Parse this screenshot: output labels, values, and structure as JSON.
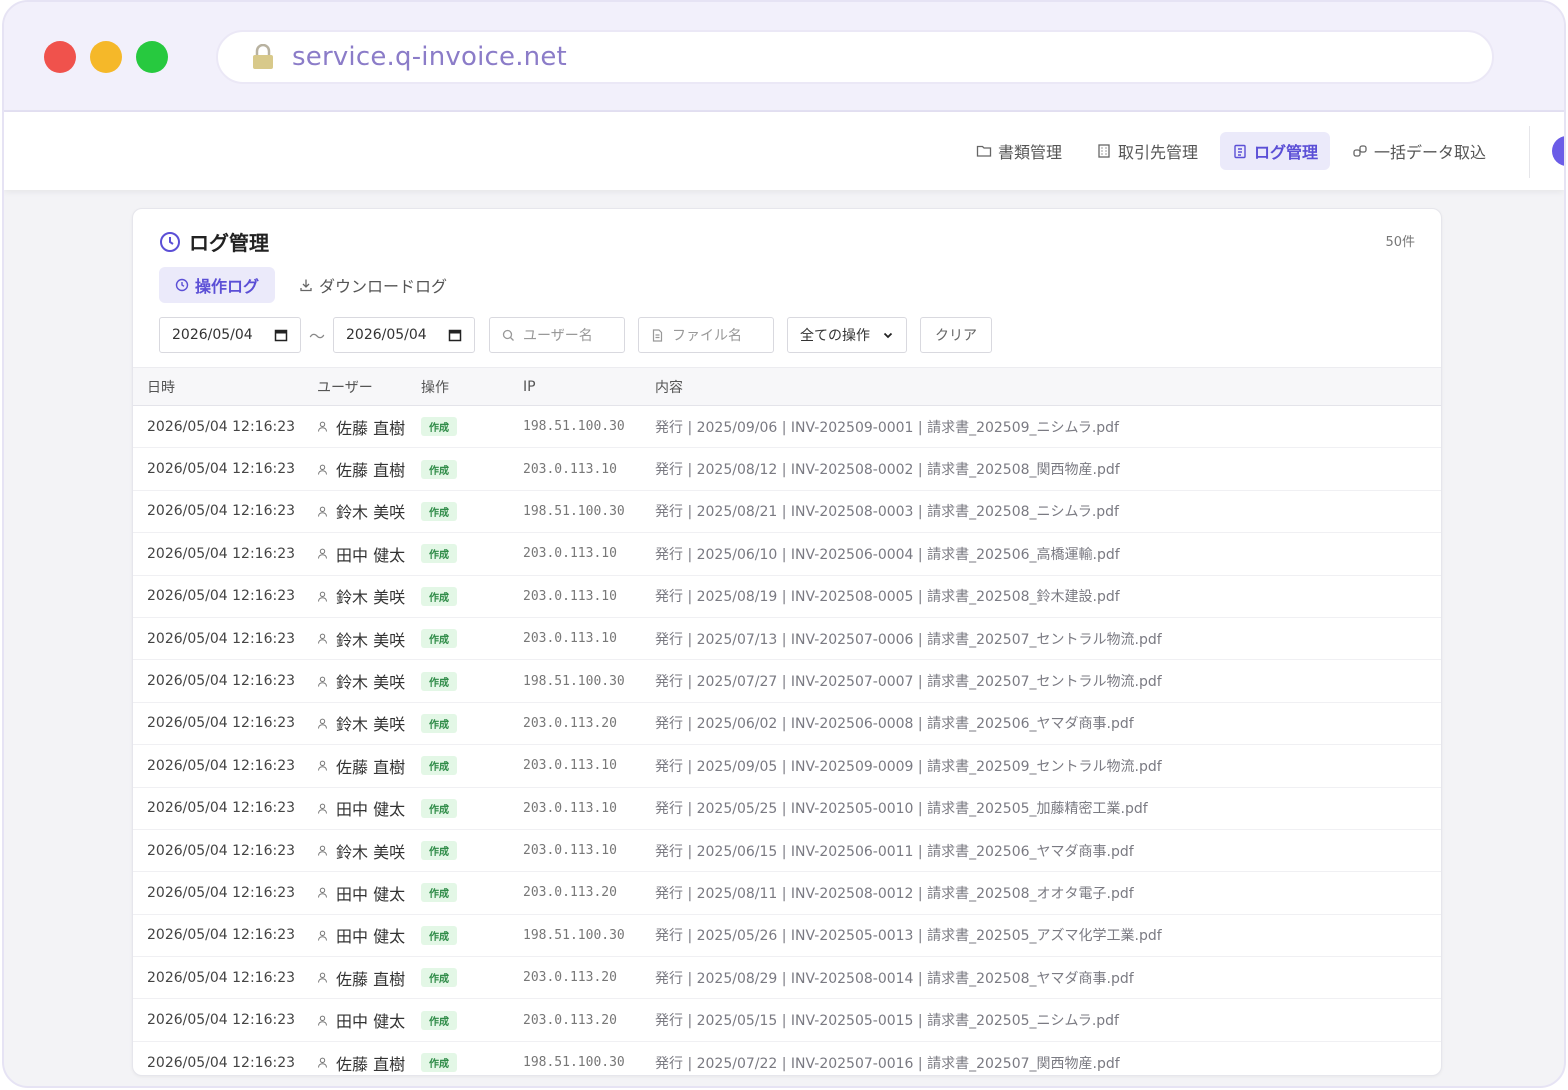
{
  "browser": {
    "url": "service.q-invoice.net"
  },
  "nav": {
    "items": [
      {
        "label": "書類管理",
        "icon": "folder-icon"
      },
      {
        "label": "取引先管理",
        "icon": "building-icon"
      },
      {
        "label": "ログ管理",
        "icon": "clipboard-icon"
      },
      {
        "label": "一括データ取込",
        "icon": "link-icon"
      }
    ],
    "active": "ログ管理"
  },
  "page": {
    "title": "ログ管理",
    "count": "50件"
  },
  "tabs": [
    {
      "label": "操作ログ",
      "icon": "clock-icon"
    },
    {
      "label": "ダウンロードログ",
      "icon": "download-icon"
    }
  ],
  "filters": {
    "date_from": "2026/05/04",
    "date_to": "2026/05/04",
    "separator": "〜",
    "user_placeholder": "ユーザー名",
    "file_placeholder": "ファイル名",
    "operation": "全ての操作",
    "clear": "クリア"
  },
  "table": {
    "headers": [
      "日時",
      "ユーザー",
      "操作",
      "IP",
      "内容"
    ],
    "rows": [
      [
        "2026/05/04 12:16:23",
        "佐藤 直樹",
        "作成",
        "198.51.100.30",
        "発行 | 2025/09/06 | INV-202509-0001 | 請求書_202509_ニシムラ.pdf"
      ],
      [
        "2026/05/04 12:16:23",
        "佐藤 直樹",
        "作成",
        "203.0.113.10",
        "発行 | 2025/08/12 | INV-202508-0002 | 請求書_202508_関西物産.pdf"
      ],
      [
        "2026/05/04 12:16:23",
        "鈴木 美咲",
        "作成",
        "198.51.100.30",
        "発行 | 2025/08/21 | INV-202508-0003 | 請求書_202508_ニシムラ.pdf"
      ],
      [
        "2026/05/04 12:16:23",
        "田中 健太",
        "作成",
        "203.0.113.10",
        "発行 | 2025/06/10 | INV-202506-0004 | 請求書_202506_高橋運輸.pdf"
      ],
      [
        "2026/05/04 12:16:23",
        "鈴木 美咲",
        "作成",
        "203.0.113.10",
        "発行 | 2025/08/19 | INV-202508-0005 | 請求書_202508_鈴木建設.pdf"
      ],
      [
        "2026/05/04 12:16:23",
        "鈴木 美咲",
        "作成",
        "203.0.113.10",
        "発行 | 2025/07/13 | INV-202507-0006 | 請求書_202507_セントラル物流.pdf"
      ],
      [
        "2026/05/04 12:16:23",
        "鈴木 美咲",
        "作成",
        "198.51.100.30",
        "発行 | 2025/07/27 | INV-202507-0007 | 請求書_202507_セントラル物流.pdf"
      ],
      [
        "2026/05/04 12:16:23",
        "鈴木 美咲",
        "作成",
        "203.0.113.20",
        "発行 | 2025/06/02 | INV-202506-0008 | 請求書_202506_ヤマダ商事.pdf"
      ],
      [
        "2026/05/04 12:16:23",
        "佐藤 直樹",
        "作成",
        "203.0.113.10",
        "発行 | 2025/09/05 | INV-202509-0009 | 請求書_202509_セントラル物流.pdf"
      ],
      [
        "2026/05/04 12:16:23",
        "田中 健太",
        "作成",
        "203.0.113.10",
        "発行 | 2025/05/25 | INV-202505-0010 | 請求書_202505_加藤精密工業.pdf"
      ],
      [
        "2026/05/04 12:16:23",
        "鈴木 美咲",
        "作成",
        "203.0.113.10",
        "発行 | 2025/06/15 | INV-202506-0011 | 請求書_202506_ヤマダ商事.pdf"
      ],
      [
        "2026/05/04 12:16:23",
        "田中 健太",
        "作成",
        "203.0.113.20",
        "発行 | 2025/08/11 | INV-202508-0012 | 請求書_202508_オオタ電子.pdf"
      ],
      [
        "2026/05/04 12:16:23",
        "田中 健太",
        "作成",
        "198.51.100.30",
        "発行 | 2025/05/26 | INV-202505-0013 | 請求書_202505_アズマ化学工業.pdf"
      ],
      [
        "2026/05/04 12:16:23",
        "佐藤 直樹",
        "作成",
        "203.0.113.20",
        "発行 | 2025/08/29 | INV-202508-0014 | 請求書_202508_ヤマダ商事.pdf"
      ],
      [
        "2026/05/04 12:16:23",
        "田中 健太",
        "作成",
        "203.0.113.20",
        "発行 | 2025/05/15 | INV-202505-0015 | 請求書_202505_ニシムラ.pdf"
      ],
      [
        "2026/05/04 12:16:23",
        "佐藤 直樹",
        "作成",
        "198.51.100.30",
        "発行 | 2025/07/22 | INV-202507-0016 | 請求書_202507_関西物産.pdf"
      ]
    ]
  },
  "colors": {
    "accent": "#5b4fd6",
    "badge_bg": "#e3f7e6",
    "badge_text": "#2e8b47"
  }
}
